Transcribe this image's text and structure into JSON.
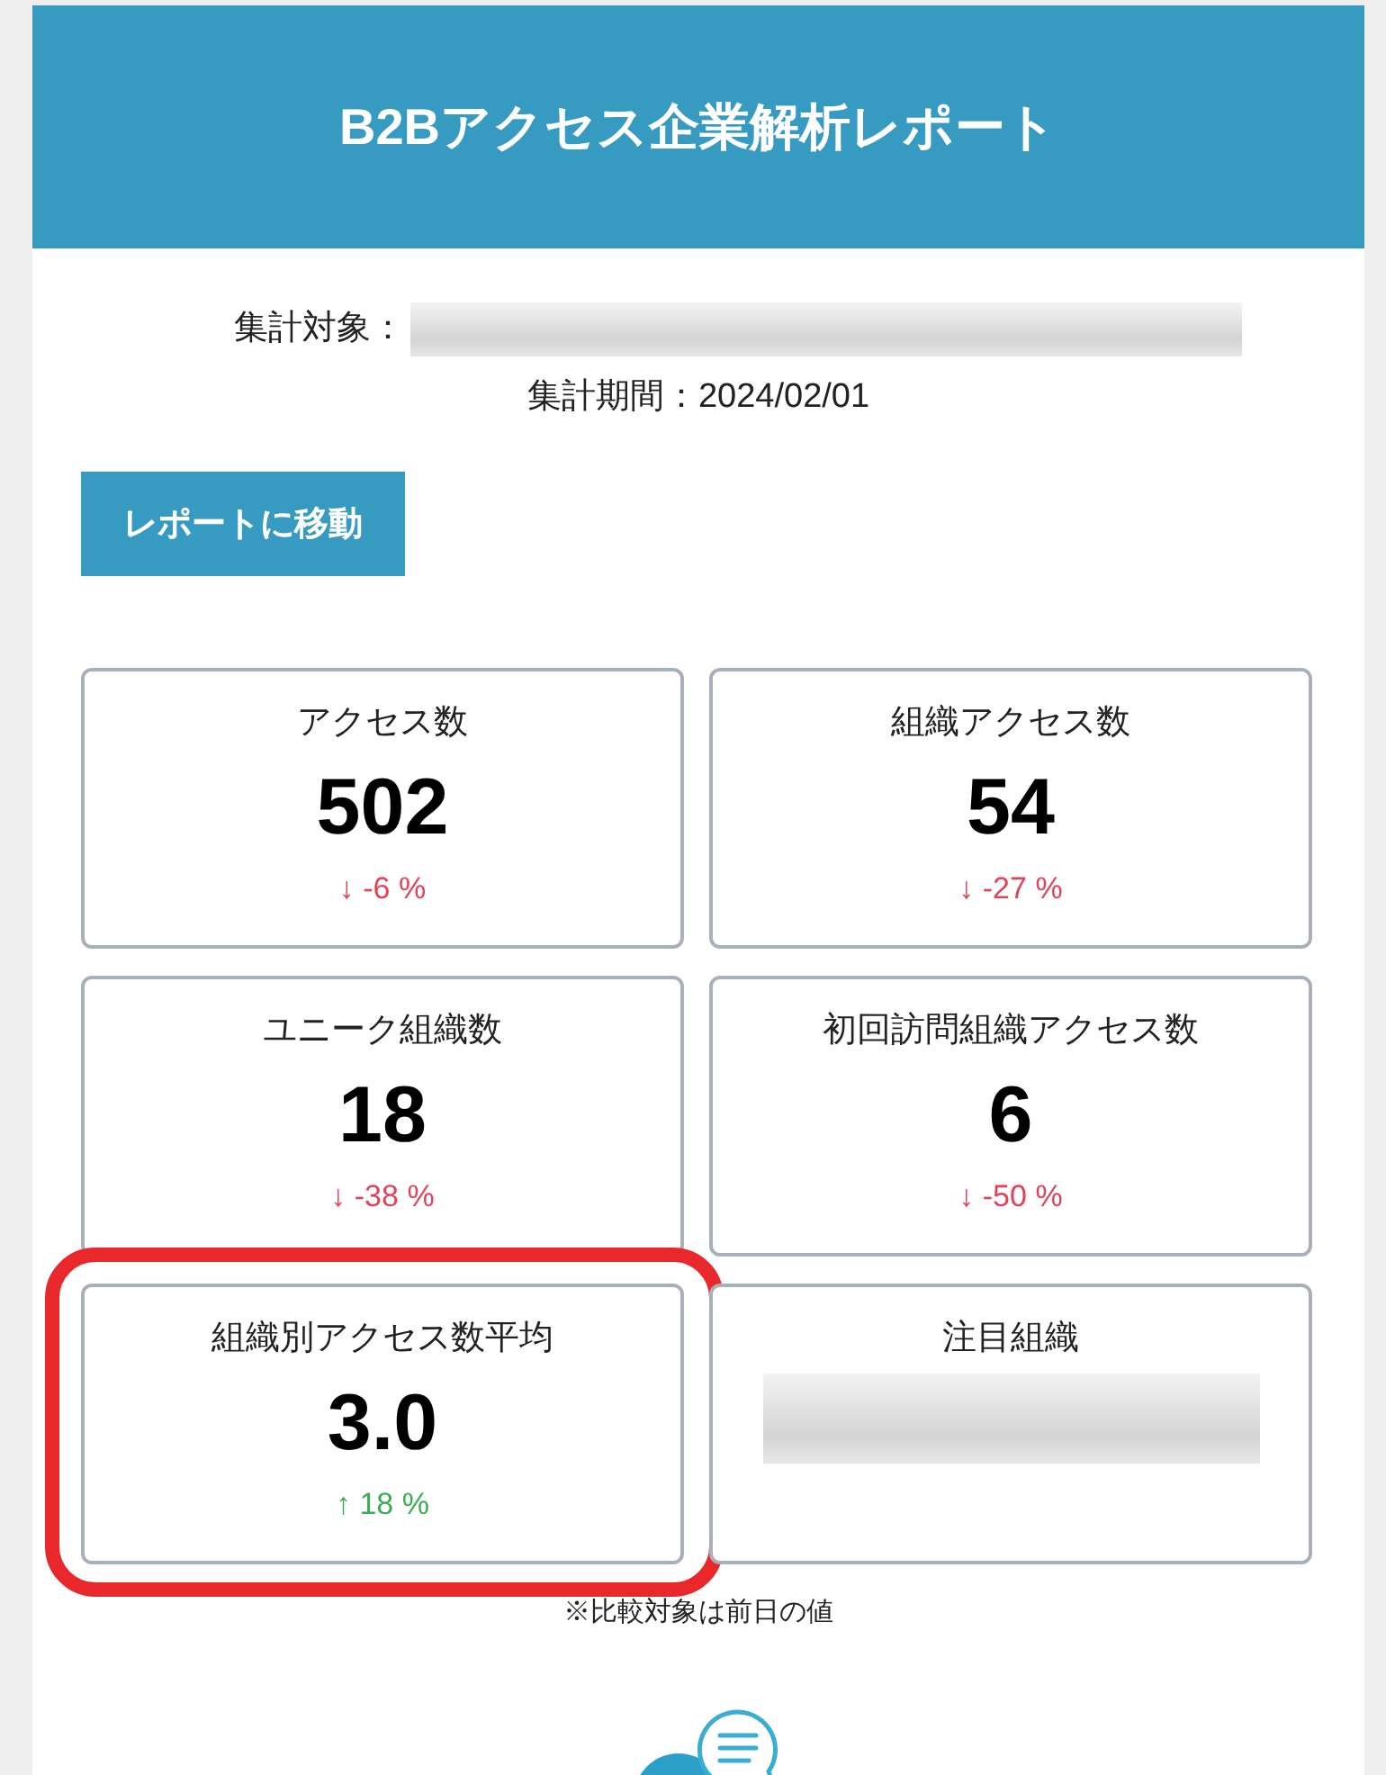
{
  "header": {
    "title": "B2Bアクセス企業解析レポート"
  },
  "summary": {
    "target": {
      "label": "集計対象：",
      "redacted": true
    },
    "period": "集計期間：2024/02/01"
  },
  "report_button": {
    "label": "レポートに移動"
  },
  "cards": [
    {
      "kind": "metric",
      "label": "アクセス数",
      "value": "502",
      "change": "↓ -6 %",
      "color": "#e2435a",
      "highlighted": false
    },
    {
      "kind": "metric",
      "label": "組織アクセス数",
      "value": "54",
      "change": "↓ -27 %",
      "color": "#e2435a",
      "highlighted": false
    },
    {
      "kind": "metric",
      "label": "ユニーク組織数",
      "value": "18",
      "change": "↓ -38 %",
      "color": "#e2435a",
      "highlighted": false
    },
    {
      "kind": "metric",
      "label": "初回訪問組織アクセス数",
      "value": "6",
      "change": "↓ -50 %",
      "color": "#e2435a",
      "highlighted": false
    },
    {
      "kind": "metric",
      "label": "組織別アクセス数平均",
      "value": "3.0",
      "change": "↑ 18 %",
      "color": "#3aae55",
      "highlighted": true
    },
    {
      "kind": "redacted",
      "label": "注目組織",
      "highlighted": false
    }
  ],
  "footnote": "※比較対象は前日の値"
}
